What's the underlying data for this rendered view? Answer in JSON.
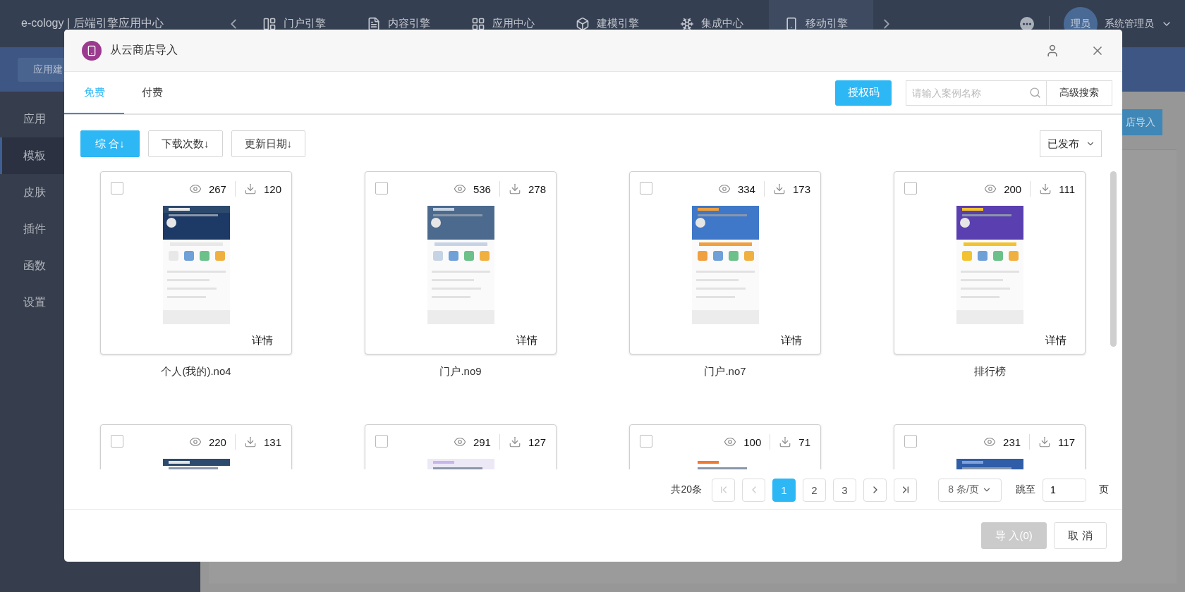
{
  "app_bar": {
    "title": "e-cology | 后端引擎应用中心",
    "nav": [
      {
        "label": "门户引擎",
        "selected": false
      },
      {
        "label": "内容引擎",
        "selected": false
      },
      {
        "label": "应用中心",
        "selected": false
      },
      {
        "label": "建模引擎",
        "selected": false
      },
      {
        "label": "集成中心",
        "selected": false
      },
      {
        "label": "移动引擎",
        "selected": true
      }
    ],
    "user": {
      "avatar_text": "理员",
      "name": "系统管理员"
    }
  },
  "sub_bar": {
    "button": "应用建"
  },
  "sidebar": {
    "items": [
      {
        "label": "应用",
        "selected": false
      },
      {
        "label": "模板",
        "selected": true
      },
      {
        "label": "皮肤",
        "selected": false
      },
      {
        "label": "插件",
        "selected": false
      },
      {
        "label": "函数",
        "selected": false
      },
      {
        "label": "设置",
        "selected": false
      }
    ]
  },
  "content": {
    "button": "店导入"
  },
  "dialog": {
    "title": "从云商店导入",
    "tabs": [
      {
        "label": "免费",
        "selected": true
      },
      {
        "label": "付费",
        "selected": false
      }
    ],
    "auth_button": "授权码",
    "search": {
      "placeholder": "请输入案例名称"
    },
    "advanced_button": "高级搜索",
    "sorts": [
      {
        "label": "综 合↓",
        "selected": true
      },
      {
        "label": "下载次数↓",
        "selected": false
      },
      {
        "label": "更新日期↓",
        "selected": false
      }
    ],
    "status_select": "已发布",
    "templates": [
      {
        "checked": false,
        "views": "267",
        "downloads": "120",
        "detail": "详情",
        "name": "个人(我的).no4"
      },
      {
        "checked": false,
        "views": "536",
        "downloads": "278",
        "detail": "详情",
        "name": "门户.no9"
      },
      {
        "checked": false,
        "views": "334",
        "downloads": "173",
        "detail": "详情",
        "name": "门户.no7"
      },
      {
        "checked": false,
        "views": "200",
        "downloads": "111",
        "detail": "详情",
        "name": "排行榜"
      },
      {
        "checked": false,
        "views": "220",
        "downloads": "131"
      },
      {
        "checked": false,
        "views": "291",
        "downloads": "127"
      },
      {
        "checked": false,
        "views": "100",
        "downloads": "71"
      },
      {
        "checked": false,
        "views": "231",
        "downloads": "117"
      }
    ],
    "pagination": {
      "total": "共20条",
      "pages": [
        {
          "label": "1",
          "selected": true
        },
        {
          "label": "2",
          "selected": false
        },
        {
          "label": "3",
          "selected": false
        }
      ],
      "page_size": "8 条/页",
      "jump_label": "跳至",
      "jump_value": "1",
      "page_suffix": "页"
    },
    "footer": {
      "import_button": {
        "label": "导 入(0)",
        "disabled": true
      },
      "cancel_button": "取 消"
    }
  }
}
